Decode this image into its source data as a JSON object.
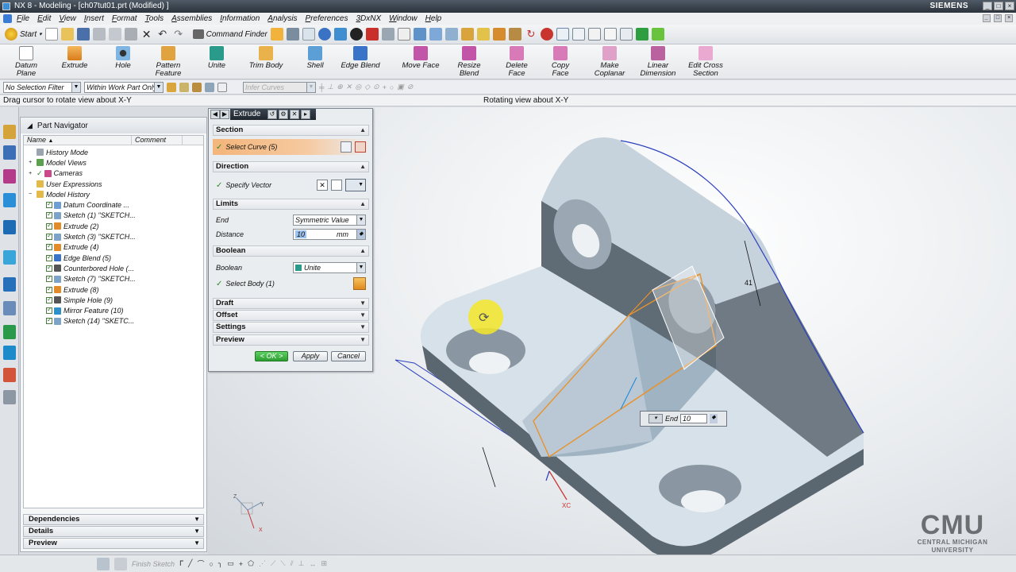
{
  "window": {
    "title": "NX 8 - Modeling - [ch07tut01.prt (Modified) ]",
    "brand": "SIEMENS"
  },
  "menu": [
    "File",
    "Edit",
    "View",
    "Insert",
    "Format",
    "Tools",
    "Assemblies",
    "Information",
    "Analysis",
    "Preferences",
    "3DxNX",
    "Window",
    "Help"
  ],
  "toolbar": {
    "start_label": "Start",
    "command_finder_label": "Command Finder"
  },
  "ribbon": [
    {
      "label": "Datum Plane",
      "icon": "datum-plane-icon"
    },
    {
      "label": "Extrude",
      "icon": "extrude-icon"
    },
    {
      "label": "Hole",
      "icon": "hole-icon"
    },
    {
      "label": "Pattern Feature",
      "icon": "pattern-feature-icon"
    },
    {
      "label": "Unite",
      "icon": "unite-icon"
    },
    {
      "label": "Trim Body",
      "icon": "trim-body-icon"
    },
    {
      "label": "Shell",
      "icon": "shell-icon"
    },
    {
      "label": "Edge Blend",
      "icon": "edge-blend-icon"
    },
    {
      "label": "Move Face",
      "icon": "move-face-icon"
    },
    {
      "label": "Resize Blend",
      "icon": "resize-blend-icon"
    },
    {
      "label": "Delete Face",
      "icon": "delete-face-icon"
    },
    {
      "label": "Copy Face",
      "icon": "copy-face-icon"
    },
    {
      "label": "Make Coplanar",
      "icon": "make-coplanar-icon"
    },
    {
      "label": "Linear Dimension",
      "icon": "linear-dimension-icon"
    },
    {
      "label": "Edit Cross Section",
      "icon": "edit-cross-section-icon"
    }
  ],
  "selection_bar": {
    "filter": "No Selection Filter",
    "scope": "Within Work Part Only",
    "curve_rule": "Infer Curves"
  },
  "cue": {
    "prompt": "Drag cursor to rotate view about X-Y",
    "status": "Rotating view about X-Y"
  },
  "navigator": {
    "title": "Part Navigator",
    "columns": [
      "Name",
      "Comment"
    ],
    "items": [
      {
        "label": "History Mode",
        "level": 1,
        "checked": false,
        "icon": "history-mode-icon"
      },
      {
        "label": "Model Views",
        "level": 1,
        "checked": false,
        "icon": "model-views-icon"
      },
      {
        "label": "Cameras",
        "level": 1,
        "checked": true,
        "icon": "cameras-icon"
      },
      {
        "label": "User Expressions",
        "level": 1,
        "checked": false,
        "icon": "user-expressions-icon"
      },
      {
        "label": "Model History",
        "level": 1,
        "checked": false,
        "icon": "model-history-icon"
      },
      {
        "label": "Datum Coordinate ...",
        "level": 2,
        "checked": true,
        "icon": "datum-csys-icon"
      },
      {
        "label": "Sketch (1) \"SKETCH...",
        "level": 2,
        "checked": true,
        "icon": "sketch-icon"
      },
      {
        "label": "Extrude (2)",
        "level": 2,
        "checked": true,
        "icon": "extrude-icon"
      },
      {
        "label": "Sketch (3) \"SKETCH...",
        "level": 2,
        "checked": true,
        "icon": "sketch-icon"
      },
      {
        "label": "Extrude (4)",
        "level": 2,
        "checked": true,
        "icon": "extrude-icon"
      },
      {
        "label": "Edge Blend (5)",
        "level": 2,
        "checked": true,
        "icon": "edge-blend-icon"
      },
      {
        "label": "Counterbored Hole (...",
        "level": 2,
        "checked": true,
        "icon": "hole-icon"
      },
      {
        "label": "Sketch (7) \"SKETCH...",
        "level": 2,
        "checked": true,
        "icon": "sketch-icon"
      },
      {
        "label": "Extrude (8)",
        "level": 2,
        "checked": true,
        "icon": "extrude-icon"
      },
      {
        "label": "Simple Hole (9)",
        "level": 2,
        "checked": true,
        "icon": "hole-icon"
      },
      {
        "label": "Mirror Feature (10)",
        "level": 2,
        "checked": true,
        "icon": "mirror-icon"
      },
      {
        "label": "Sketch (14) \"SKETC...",
        "level": 2,
        "checked": true,
        "icon": "sketch-icon"
      }
    ],
    "panels": [
      "Dependencies",
      "Details",
      "Preview"
    ]
  },
  "extrude_dialog": {
    "title": "Extrude",
    "sections": {
      "section": "Section",
      "direction": "Direction",
      "limits": "Limits",
      "boolean": "Boolean",
      "draft": "Draft",
      "offset": "Offset",
      "settings": "Settings",
      "preview": "Preview"
    },
    "select_curve": "Select Curve (5)",
    "specify_vector": "Specify Vector",
    "end_label": "End",
    "end_value": "Symmetric Value",
    "distance_label": "Distance",
    "distance_value": "10",
    "distance_unit": "mm",
    "boolean_label": "Boolean",
    "boolean_value": "Unite",
    "select_body": "Select Body (1)",
    "ok": "< OK >",
    "apply": "Apply",
    "cancel": "Cancel"
  },
  "graphics": {
    "end_label": "End",
    "end_value": "10",
    "triad": {
      "x": "X",
      "y": "Y",
      "z": "Z"
    },
    "csys_label": "XC"
  },
  "bottom_bar": {
    "finish_sketch": "Finish Sketch"
  },
  "logo": {
    "name": "CMU",
    "line1": "CENTRAL MICHIGAN",
    "line2": "UNIVERSITY"
  },
  "colors": {
    "accent_orange": "#f0a257",
    "edge_blue": "#2a3fbf",
    "preview_orange": "#e8922c",
    "part_face_light": "#c9d6e0",
    "part_face_dark": "#5f6b75"
  }
}
